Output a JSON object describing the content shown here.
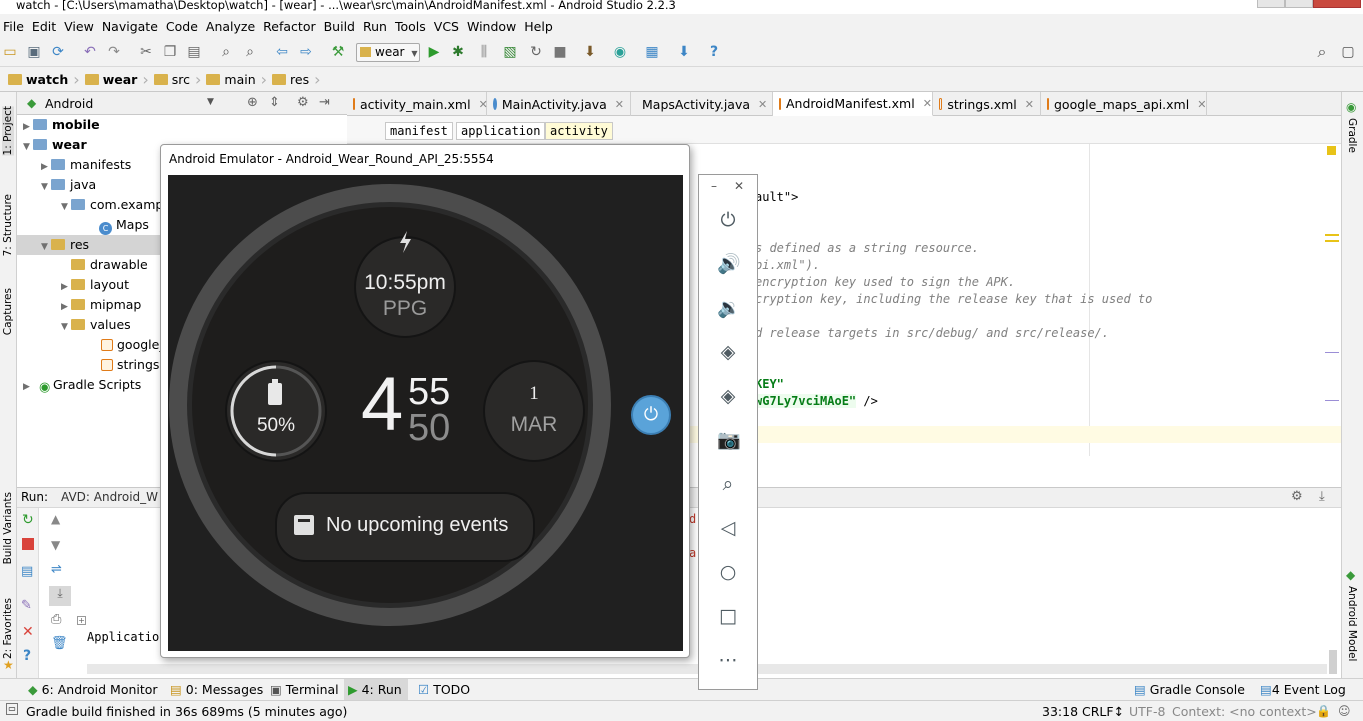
{
  "window_title": "watch - [C:\\Users\\mamatha\\Desktop\\watch] - [wear] - ...\\wear\\src\\main\\AndroidManifest.xml - Android Studio 2.2.3",
  "menu": [
    "File",
    "Edit",
    "View",
    "Navigate",
    "Code",
    "Analyze",
    "Refactor",
    "Build",
    "Run",
    "Tools",
    "VCS",
    "Window",
    "Help"
  ],
  "toolbar": {
    "config": "wear"
  },
  "breadcrumbs": [
    "watch",
    "wear",
    "src",
    "main",
    "res"
  ],
  "project": {
    "view_mode": "Android",
    "tree": [
      {
        "label": "mobile"
      },
      {
        "label": "wear"
      },
      {
        "label": "manifests"
      },
      {
        "label": "java"
      },
      {
        "label": "com.examp"
      },
      {
        "label": "Maps"
      },
      {
        "label": "res"
      },
      {
        "label": "drawable"
      },
      {
        "label": "layout"
      },
      {
        "label": "mipmap"
      },
      {
        "label": "values"
      },
      {
        "label": "google_"
      },
      {
        "label": "strings.x"
      },
      {
        "label": "Gradle Scripts"
      }
    ]
  },
  "left_strip": {
    "project": "1: Project",
    "structure": "7: Structure",
    "captures": "Captures",
    "variants": "Build Variants",
    "favorites": "2: Favorites"
  },
  "right_strip": {
    "gradle": "Gradle",
    "android_model": "Android Model"
  },
  "tabs": [
    {
      "label": "activity_main.xml"
    },
    {
      "label": "MainActivity.java"
    },
    {
      "label": "MapsActivity.java"
    },
    {
      "label": "AndroidManifest.xml"
    },
    {
      "label": "strings.xml"
    },
    {
      "label": "google_maps_api.xml"
    }
  ],
  "xml_path": [
    "manifest",
    "application",
    "activity"
  ],
  "code": {
    "l1": "ault\">",
    "l2": "s defined as a string resource.",
    "l3": "pi.xml\").",
    "l4": "encryption key used to sign the APK.",
    "l5": "cryption key, including the release key that is used to",
    "l6": "d release targets in src/debug/ and src/release/.",
    "l7": "KEY\"",
    "l8": "wG7Ly7vciMAoE\"",
    "l8b": " />"
  },
  "run": {
    "label": "Run:",
    "config": "AVD: Android_W",
    "frag1": "6)",
    "frag2": "a",
    "output": "Applicatio"
  },
  "emulator": {
    "title": "Android Emulator - Android_Wear_Round_API_25:5554",
    "time": "10:55pm",
    "time_sub": "PPG",
    "battery": "50%",
    "hour": "4",
    "min": "55",
    "sec": "50",
    "day": "1",
    "month": "MAR",
    "events": "No upcoming events"
  },
  "bottom_tabs": [
    "6: Android Monitor",
    "0: Messages",
    "Terminal",
    "4: Run",
    "TODO"
  ],
  "bottom_right": [
    "Gradle Console",
    "4 Event Log"
  ],
  "status": {
    "message": "Gradle build finished in 36s 689ms (5 minutes ago)",
    "position": "33:18",
    "line_sep": "CRLF↕",
    "encoding": "UTF-8",
    "context": "Context: <no context>"
  },
  "colors": {
    "accent": "#4a90c9",
    "folder": "#d9b24c",
    "bg": "#f2f2f2"
  }
}
